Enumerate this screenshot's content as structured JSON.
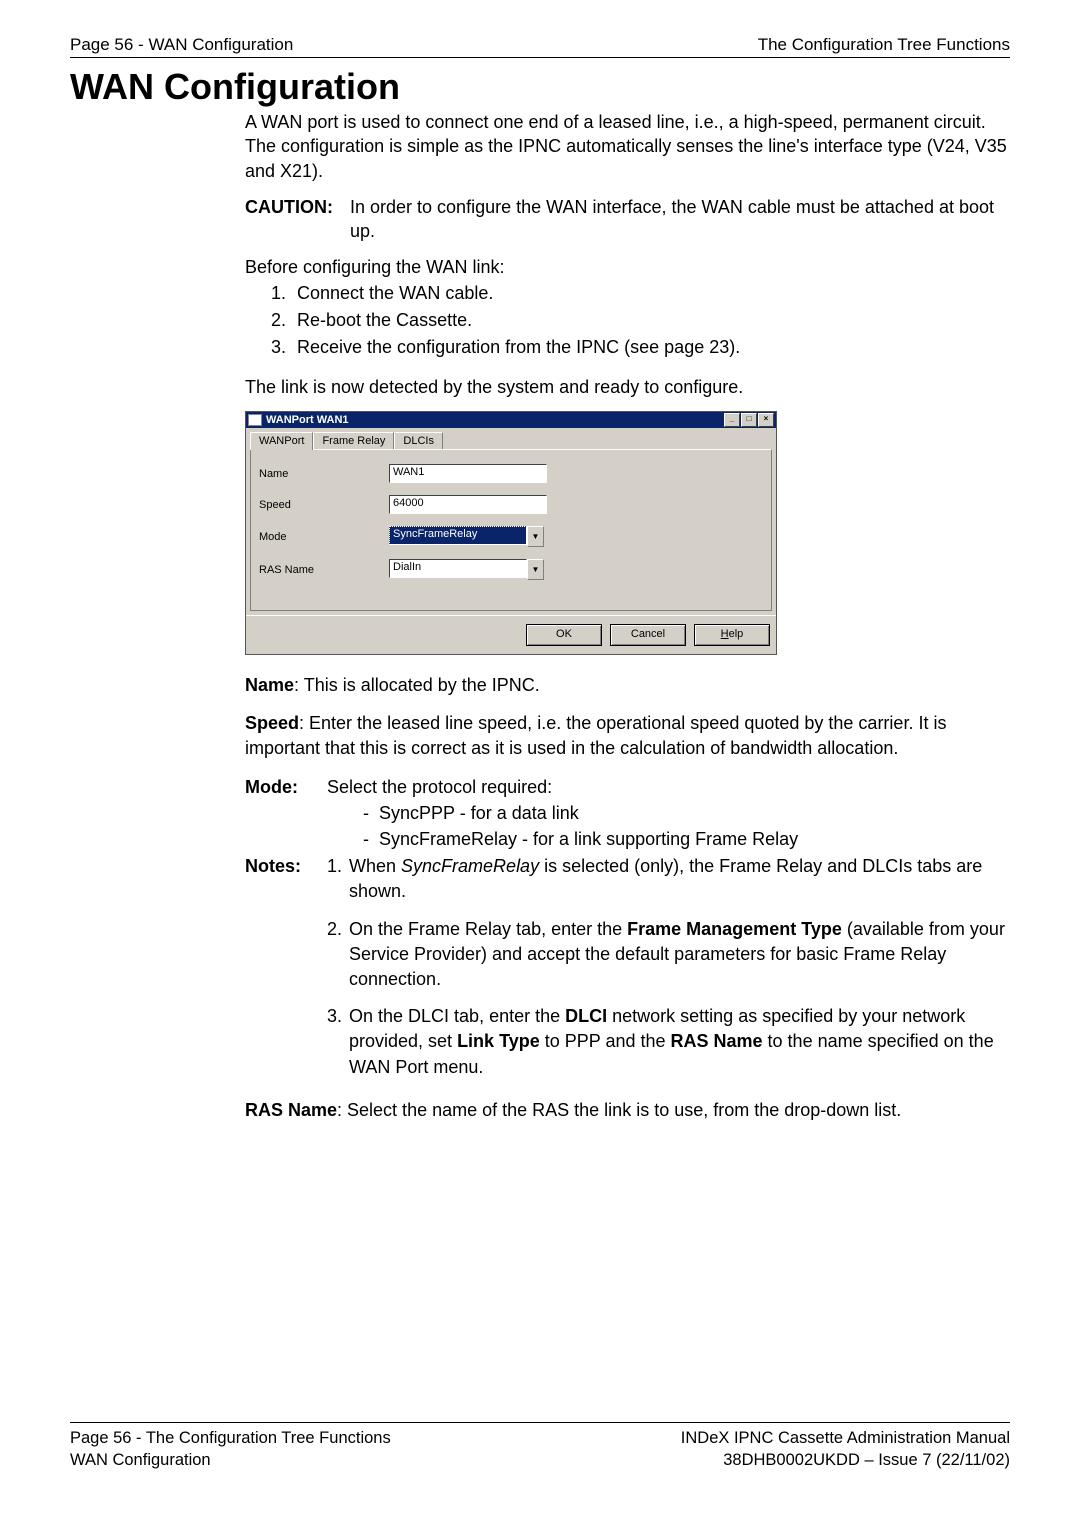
{
  "header": {
    "left": "Page 56 - WAN Configuration",
    "right": "The Configuration Tree Functions"
  },
  "title": "WAN Configuration",
  "intro": "A WAN port is used to connect one end of a leased line, i.e., a high-speed, permanent circuit. The configuration is simple as the IPNC automatically senses the line's interface type (V24, V35 and X21).",
  "caution": {
    "label": "CAUTION:",
    "text": "In order to configure the WAN interface, the WAN cable must be attached at boot up."
  },
  "before_line": "Before configuring the WAN link:",
  "steps": [
    "Connect the WAN cable.",
    "Re-boot the Cassette.",
    "Receive the configuration from the IPNC (see page 23)."
  ],
  "detected_line": "The link is now detected by the system and ready to configure.",
  "dialog": {
    "title": "WANPort WAN1",
    "tabs": [
      "WANPort",
      "Frame Relay",
      "DLCIs"
    ],
    "fields": {
      "name": {
        "label": "Name",
        "value": "WAN1"
      },
      "speed": {
        "label": "Speed",
        "value": "64000"
      },
      "mode": {
        "label": "Mode",
        "value": "SyncFrameRelay"
      },
      "ras": {
        "label": "RAS Name",
        "value": "DialIn"
      }
    },
    "buttons": {
      "ok": "OK",
      "cancel": "Cancel",
      "help": "Help"
    },
    "help_underline": "H"
  },
  "desc": {
    "name_label": "Name",
    "name_text": ": This is allocated by the IPNC.",
    "speed_label": "Speed",
    "speed_text": ": Enter the leased line speed, i.e. the operational speed quoted by the carrier. It is important that this is correct as it is used in the calculation of bandwidth allocation.",
    "mode_label": "Mode:",
    "mode_intro": "Select the protocol required:",
    "mode_items": [
      "SyncPPP - for a data link",
      "SyncFrameRelay - for a link supporting Frame Relay"
    ],
    "notes_label": "Notes:",
    "note1_pre": "When ",
    "note1_em": "SyncFrameRelay",
    "note1_post": " is selected (only), the Frame Relay and DLCIs tabs are shown.",
    "note2_pre": "On the Frame Relay tab, enter the ",
    "note2_b": "Frame Management Type",
    "note2_post": " (available from your Service Provider) and accept the default parameters for basic Frame Relay connection.",
    "note3_pre": "On the DLCI tab, enter the ",
    "note3_b1": "DLCI",
    "note3_mid1": " network setting as specified by your network provided, set ",
    "note3_b2": "Link Type",
    "note3_mid2": " to PPP and the ",
    "note3_b3": "RAS Name",
    "note3_post": " to the name specified on the WAN Port menu.",
    "ras_label": "RAS Name",
    "ras_text": ": Select the name of the RAS the link is to use, from the drop-down list."
  },
  "footer": {
    "left1": "Page 56 - The Configuration Tree Functions",
    "left2": "WAN Configuration",
    "right1": "INDeX IPNC Cassette Administration Manual",
    "right2": "38DHB0002UKDD – Issue 7 (22/11/02)"
  }
}
